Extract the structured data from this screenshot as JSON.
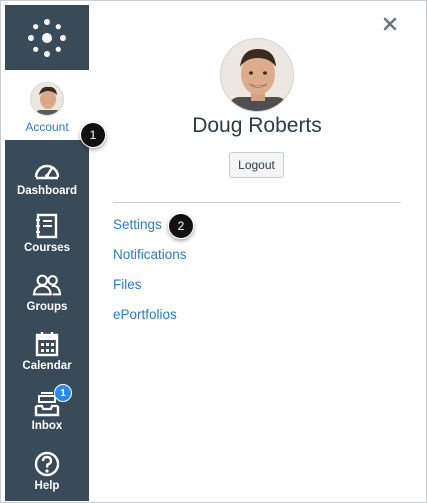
{
  "nav": {
    "account": {
      "label": "Account"
    },
    "items": [
      {
        "label": "Dashboard",
        "icon": "dashboard-icon"
      },
      {
        "label": "Courses",
        "icon": "courses-icon"
      },
      {
        "label": "Groups",
        "icon": "groups-icon"
      },
      {
        "label": "Calendar",
        "icon": "calendar-icon"
      },
      {
        "label": "Inbox",
        "icon": "inbox-icon",
        "badge": "1"
      },
      {
        "label": "Help",
        "icon": "help-icon"
      }
    ]
  },
  "callouts": [
    "1",
    "2"
  ],
  "tray": {
    "user_name": "Doug Roberts",
    "logout_label": "Logout",
    "links": [
      "Settings",
      "Notifications",
      "Files",
      "ePortfolios"
    ]
  },
  "colors": {
    "nav_bg": "#394b58",
    "link": "#2d7bc2",
    "badge": "#2a8ae6",
    "text": "#2d3b45"
  }
}
